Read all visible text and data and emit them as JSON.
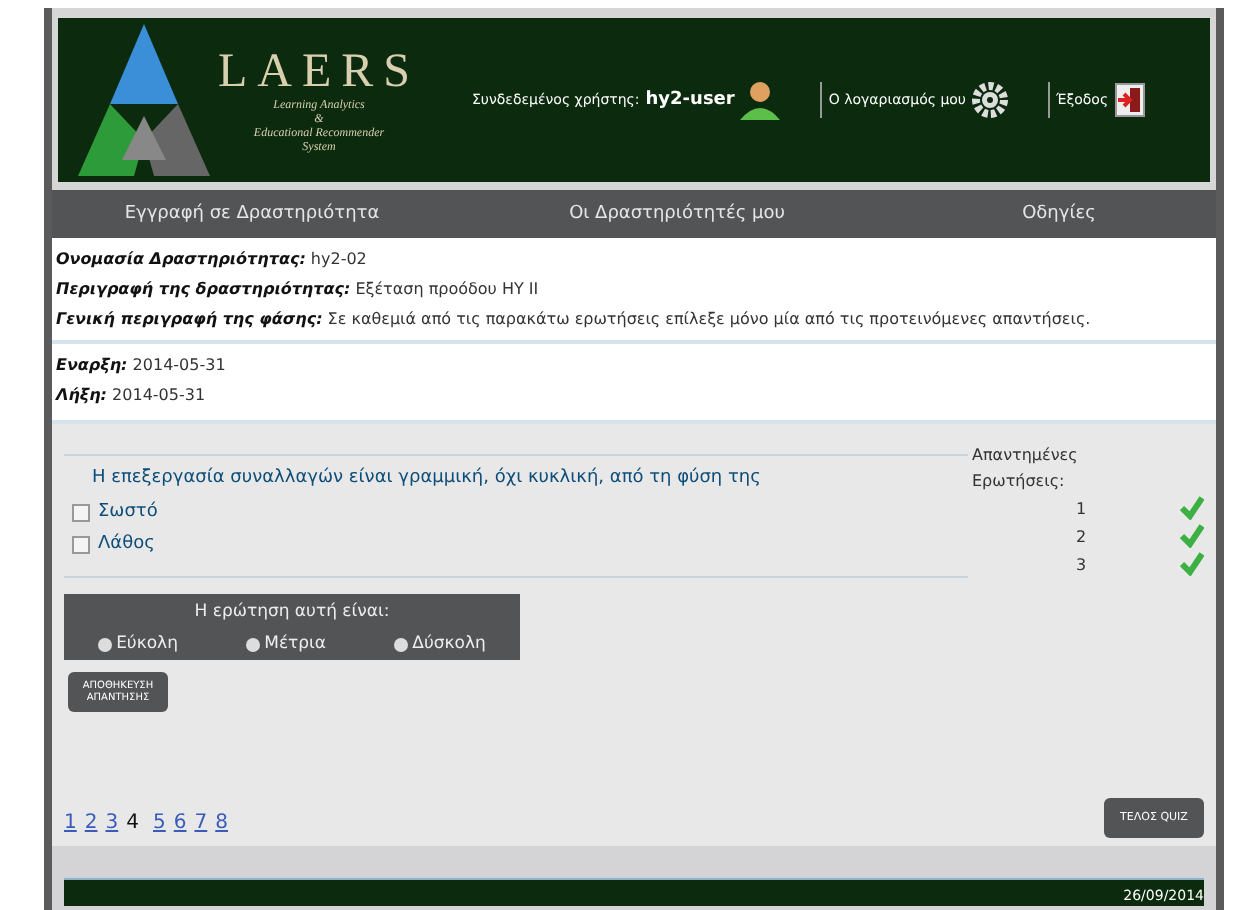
{
  "header": {
    "logo_title": "LAERS",
    "logo_subtitle": [
      "Learning Analytics",
      "&",
      "Educational Recommender",
      "System"
    ],
    "user_label": "Συνδεδεμένος χρήστης:",
    "user_name": "hy2-user",
    "account": "Ο λογαριασμός μου",
    "logout": "Έξοδος"
  },
  "nav": [
    "Εγγραφή σε Δραστηριότητα",
    "Οι Δραστηριότητές μου",
    "Οδηγίες"
  ],
  "info": [
    {
      "label": "Ονομασία Δραστηριότητας:",
      "value": "hy2-02"
    },
    {
      "label": "Περιγραφή της δραστηριότητας:",
      "value": "Εξέταση προόδου ΗΥ ΙΙ"
    },
    {
      "label": "Γενική περιγραφή της φάσης:",
      "value": "Σε καθεμιά από τις παρακάτω ερωτήσεις επίλεξε μόνο μία από τις προτεινόμενες απαντήσεις."
    }
  ],
  "dates": [
    {
      "label": "Εναρξη:",
      "value": "2014-05-31"
    },
    {
      "label": "Λήξη:",
      "value": "2014-05-31"
    }
  ],
  "question": {
    "text": "Η επεξεργασία συναλλαγών είναι γραμμική, όχι κυκλική, από τη φύση της",
    "options": [
      {
        "label": "Σωστό",
        "checked": false
      },
      {
        "label": "Λάθος",
        "checked": false
      }
    ]
  },
  "answered": {
    "title": "Απαντημένες Ερωτήσεις:",
    "items": [
      {
        "number": "1",
        "done": true
      },
      {
        "number": "2",
        "done": true
      },
      {
        "number": "3",
        "done": true
      }
    ]
  },
  "difficulty": {
    "title": "Η ερώτηση αυτή είναι:",
    "options": [
      {
        "label": "Εύκολη",
        "selected": false
      },
      {
        "label": "Μέτρια",
        "selected": false
      },
      {
        "label": "Δύσκολη",
        "selected": false
      }
    ]
  },
  "save_button": "ΑΠΟΘΗΚΕΥΣΗ ΑΠΑΝΤΗΣΗΣ",
  "pages": [
    {
      "label": "1",
      "selected": false
    },
    {
      "label": "2",
      "selected": false
    },
    {
      "label": "3",
      "selected": false
    },
    {
      "label": "4",
      "selected": true
    },
    {
      "label": "5",
      "selected": false
    },
    {
      "label": "6",
      "selected": false
    },
    {
      "label": "7",
      "selected": false
    },
    {
      "label": "8",
      "selected": false
    }
  ],
  "end_button": "ΤΕΛΟΣ QUIZ",
  "footer_date": "26/09/2014"
}
